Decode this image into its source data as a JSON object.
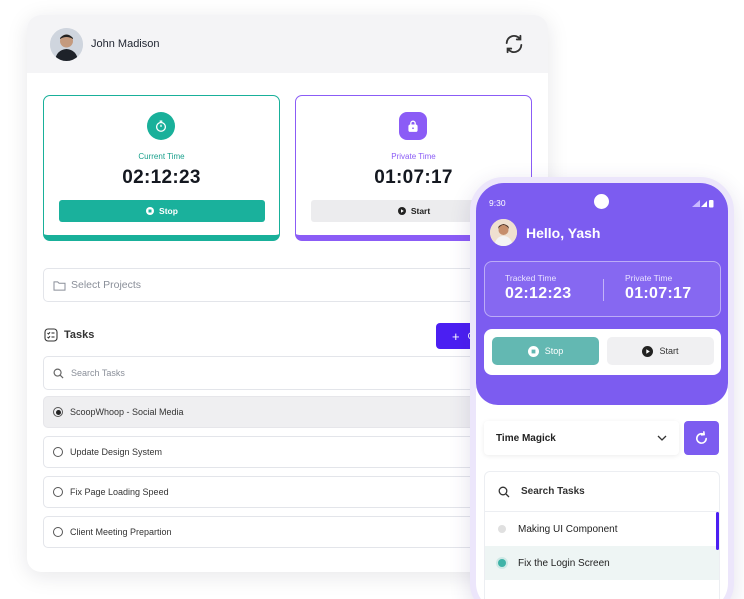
{
  "desktop": {
    "user_name": "John Madison",
    "current": {
      "label": "Current Time",
      "value": "02:12:23",
      "button": "Stop"
    },
    "private": {
      "label": "Private Time",
      "value": "01:07:17",
      "button": "Start"
    },
    "select_projects": "Select Projects",
    "tasks_title": "Tasks",
    "add_label": "+",
    "add_text": "C",
    "search_placeholder": "Search Tasks",
    "tasks": [
      {
        "label": "ScoopWhoop - Social Media",
        "selected": true
      },
      {
        "label": "Update Design System",
        "selected": false
      },
      {
        "label": "Fix Page Loading Speed",
        "selected": false
      },
      {
        "label": "Client Meeting Prepartion",
        "selected": false
      }
    ]
  },
  "mobile": {
    "status_time": "9:30",
    "greeting": "Hello, Yash",
    "tracked": {
      "label": "Tracked Time",
      "value": "02:12:23"
    },
    "private": {
      "label": "Private Time",
      "value": "01:07:17"
    },
    "stop_label": "Stop",
    "start_label": "Start",
    "project": "Time Magick",
    "search_label": "Search Tasks",
    "tasks": [
      {
        "label": "Making UI Component",
        "dot_color": "#e0e0e0"
      },
      {
        "label": "Fix the Login Screen",
        "dot_color": "#3fb3a7"
      }
    ]
  },
  "colors": {
    "green": "#19b09a",
    "purple": "#8b5cf6",
    "indigo": "#4b1ff2",
    "phone_purple": "#7c5cf0"
  }
}
